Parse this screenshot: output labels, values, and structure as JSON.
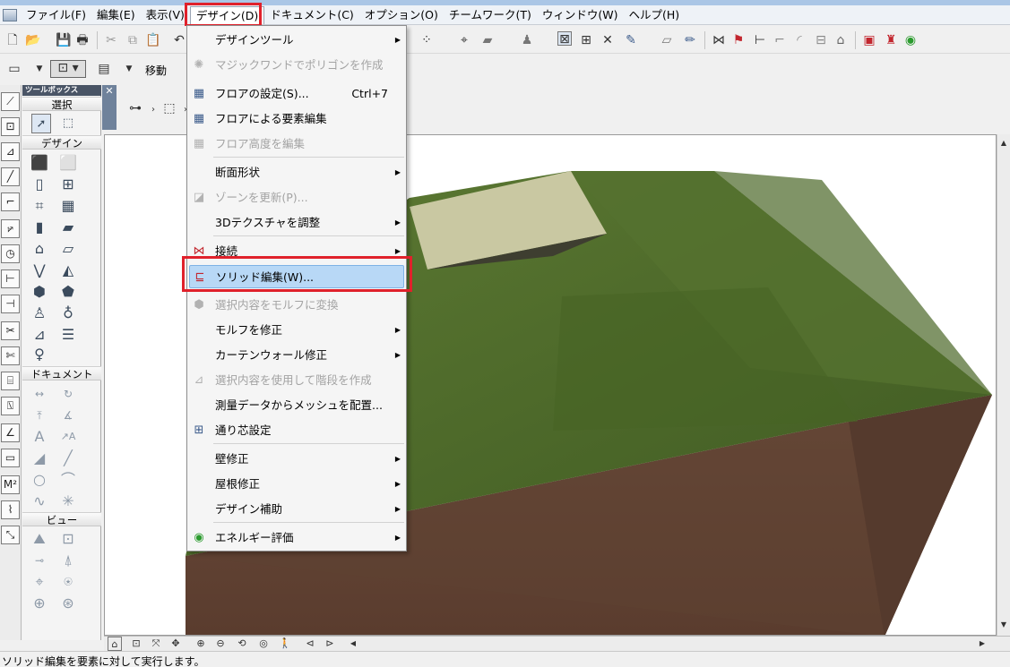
{
  "menubar": {
    "items": [
      {
        "label": "ファイル(F)"
      },
      {
        "label": "編集(E)"
      },
      {
        "label": "表示(V)"
      },
      {
        "label": "デザイン(D)"
      },
      {
        "label": "ドキュメント(C)"
      },
      {
        "label": "オプション(O)"
      },
      {
        "label": "チームワーク(T)"
      },
      {
        "label": "ウィンドウ(W)"
      },
      {
        "label": "ヘルプ(H)"
      }
    ]
  },
  "toolbar2": {
    "move_label": "移動"
  },
  "toolbox": {
    "title": "ツールボックス",
    "sections": {
      "select": "選択",
      "design": "デザイン",
      "document": "ドキュメント",
      "view": "ビュー"
    }
  },
  "design_menu": {
    "items": [
      {
        "label": "デザインツール",
        "submenu": true,
        "disabled": false
      },
      {
        "label": "マジックワンドでポリゴンを作成",
        "disabled": true
      },
      {
        "label": "フロアの設定(S)...",
        "shortcut": "Ctrl+7",
        "disabled": false
      },
      {
        "label": "フロアによる要素編集",
        "disabled": false
      },
      {
        "label": "フロア高度を編集",
        "disabled": true
      },
      {
        "label": "断面形状",
        "submenu": true,
        "disabled": false
      },
      {
        "label": "ゾーンを更新(P)...",
        "disabled": true
      },
      {
        "label": "3Dテクスチャを調整",
        "submenu": true,
        "disabled": false
      },
      {
        "label": "接続",
        "submenu": true,
        "disabled": false
      },
      {
        "label": "ソリッド編集(W)...",
        "highlighted": true,
        "disabled": false
      },
      {
        "label": "選択内容をモルフに変換",
        "disabled": true
      },
      {
        "label": "モルフを修正",
        "submenu": true,
        "disabled": false
      },
      {
        "label": "カーテンウォール修正",
        "submenu": true,
        "disabled": false
      },
      {
        "label": "選択内容を使用して階段を作成",
        "disabled": true
      },
      {
        "label": "測量データからメッシュを配置...",
        "disabled": false
      },
      {
        "label": "通り芯設定",
        "disabled": false
      },
      {
        "label": "壁修正",
        "submenu": true,
        "disabled": false
      },
      {
        "label": "屋根修正",
        "submenu": true,
        "disabled": false
      },
      {
        "label": "デザイン補助",
        "submenu": true,
        "disabled": false
      },
      {
        "label": "エネルギー評価",
        "submenu": true,
        "disabled": false
      }
    ]
  },
  "status_bar": {
    "text": "ソリッド編集を要素に対して実行します。"
  },
  "colors": {
    "highlight_box": "#e0212b",
    "menu_highlight": "#b8d8f6",
    "terrain_green": "#4f6b2a",
    "soil_brown": "#6b4a3a"
  }
}
